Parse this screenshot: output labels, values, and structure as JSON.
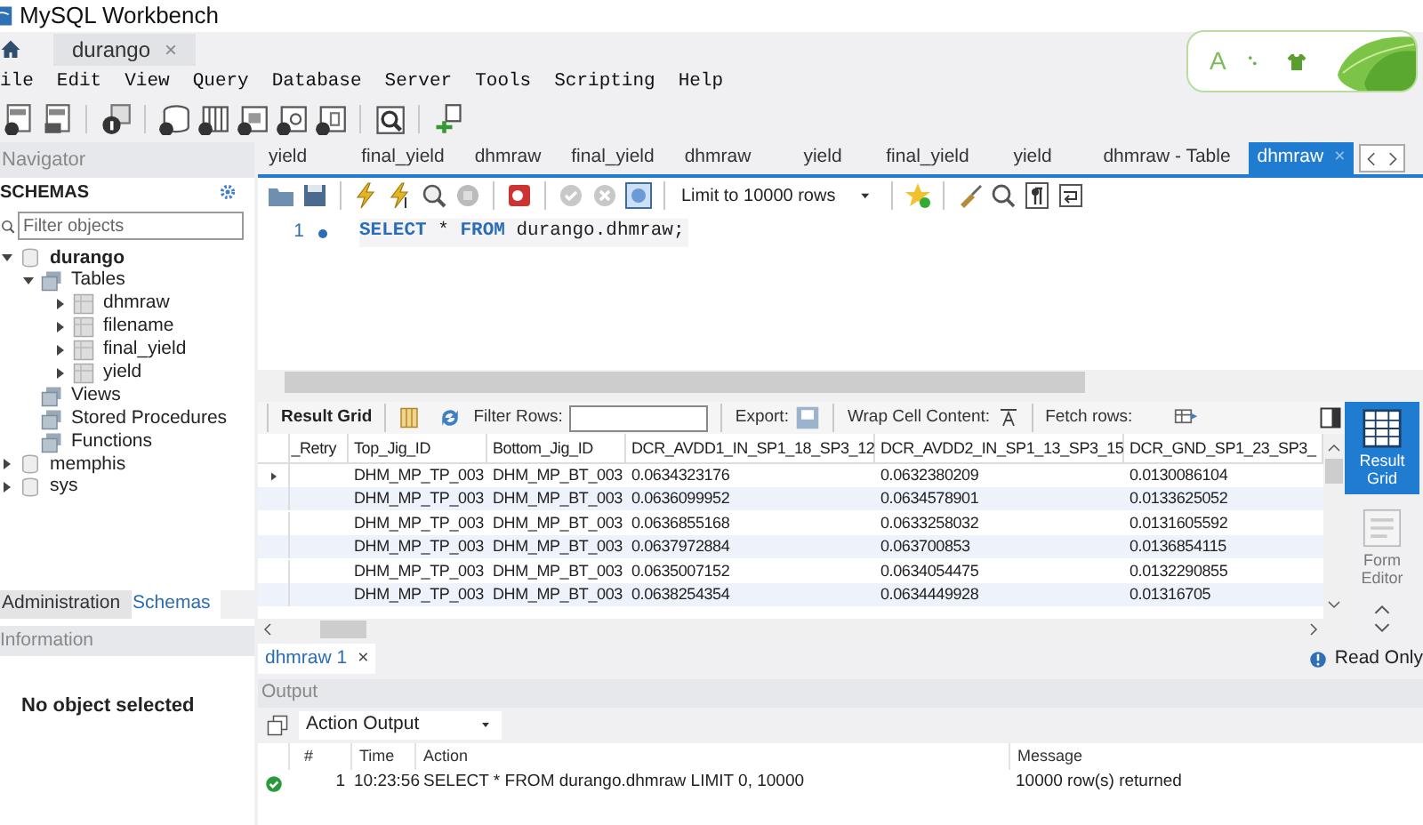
{
  "window": {
    "title": "MySQL Workbench"
  },
  "connection_tab": {
    "label": "durango",
    "close_glyph": "×"
  },
  "ime_widget": {
    "label": "A"
  },
  "menu": [
    "ile",
    "Edit",
    "View",
    "Query",
    "Database",
    "Server",
    "Tools",
    "Scripting",
    "Help"
  ],
  "navigator": {
    "title": "Navigator",
    "section": "SCHEMAS",
    "filter_placeholder": "Filter objects",
    "tree": [
      {
        "label": "durango",
        "kind": "schema",
        "active": true,
        "expanded": true,
        "children": [
          {
            "label": "Tables",
            "kind": "folder",
            "expanded": true,
            "children": [
              {
                "label": "dhmraw",
                "kind": "table",
                "expanded": false
              },
              {
                "label": "filename",
                "kind": "table",
                "expanded": false
              },
              {
                "label": "final_yield",
                "kind": "table",
                "expanded": false
              },
              {
                "label": "yield",
                "kind": "table",
                "expanded": false
              }
            ]
          },
          {
            "label": "Views",
            "kind": "folder"
          },
          {
            "label": "Stored Procedures",
            "kind": "folder"
          },
          {
            "label": "Functions",
            "kind": "folder"
          }
        ]
      },
      {
        "label": "memphis",
        "kind": "schema",
        "active": false,
        "expanded": false
      },
      {
        "label": "sys",
        "kind": "schema",
        "active": false,
        "expanded": false
      }
    ]
  },
  "navigator_tabs": [
    {
      "label": "Administration",
      "selected": false
    },
    {
      "label": "Schemas",
      "selected": true
    }
  ],
  "information": {
    "title": "Information",
    "message": "No object selected"
  },
  "query_tabs": [
    {
      "label": "yield",
      "selected": false
    },
    {
      "label": "final_yield",
      "selected": false
    },
    {
      "label": "dhmraw",
      "selected": false
    },
    {
      "label": "final_yield",
      "selected": false
    },
    {
      "label": "dhmraw",
      "selected": false
    },
    {
      "label": "yield",
      "selected": false
    },
    {
      "label": "final_yield",
      "selected": false
    },
    {
      "label": "yield",
      "selected": false
    },
    {
      "label": "dhmraw - Table",
      "selected": false
    },
    {
      "label": "dhmraw",
      "selected": true,
      "close_glyph": "×"
    }
  ],
  "editor": {
    "limit": "Limit to 10000 rows",
    "lines": [
      {
        "number": "1",
        "tokens": [
          {
            "text": "SELECT",
            "kind": "keyword"
          },
          {
            "text": " * ",
            "kind": "plain"
          },
          {
            "text": "FROM",
            "kind": "keyword"
          },
          {
            "text": " durango.dhmraw;",
            "kind": "plain"
          }
        ]
      }
    ]
  },
  "result_toolbar": {
    "grid_label": "Result Grid",
    "filter_label": "Filter Rows:",
    "export_label": "Export:",
    "wrap_label": "Wrap Cell Content:",
    "fetch_label": "Fetch rows:"
  },
  "result_grid": {
    "columns": [
      "_Retry",
      "Top_Jig_ID",
      "Bottom_Jig_ID",
      "DCR_AVDD1_IN_SP1_18_SP3_12",
      "DCR_AVDD2_IN_SP1_13_SP3_15",
      "DCR_GND_SP1_23_SP3_"
    ],
    "rows": [
      {
        "current": true,
        "cells": [
          "",
          "DHM_MP_TP_003",
          "DHM_MP_BT_003",
          "0.0634323176",
          "0.0632380209",
          "0.0130086104"
        ]
      },
      {
        "current": false,
        "cells": [
          "",
          "DHM_MP_TP_003",
          "DHM_MP_BT_003",
          "0.0636099952",
          "0.0634578901",
          "0.0133625052"
        ]
      },
      {
        "current": false,
        "cells": [
          "",
          "DHM_MP_TP_003",
          "DHM_MP_BT_003",
          "0.0636855168",
          "0.0633258032",
          "0.0131605592"
        ]
      },
      {
        "current": false,
        "cells": [
          "",
          "DHM_MP_TP_003",
          "DHM_MP_BT_003",
          "0.0637972884",
          "0.063700853",
          "0.0136854115"
        ]
      },
      {
        "current": false,
        "cells": [
          "",
          "DHM_MP_TP_003",
          "DHM_MP_BT_003",
          "0.0635007152",
          "0.0634054475",
          "0.0132290855"
        ]
      },
      {
        "current": false,
        "cells": [
          "",
          "DHM_MP_TP_003",
          "DHM_MP_BT_003",
          "0.0638254354",
          "0.0634449928",
          "0.01316705"
        ]
      }
    ]
  },
  "side_panel": [
    {
      "label": "Result Grid",
      "selected": true
    },
    {
      "label": "Form Editor",
      "selected": false
    }
  ],
  "result_tabs": [
    {
      "label": "dhmraw 1",
      "close_glyph": "×",
      "selected": true
    }
  ],
  "read_only": "Read Only",
  "output": {
    "title": "Output",
    "mode": "Action Output",
    "columns": [
      "#",
      "Time",
      "Action",
      "Message"
    ],
    "rows": [
      {
        "succeeded": true,
        "number": "1",
        "time": "10:23:56",
        "action": "SELECT * FROM durango.dhmraw LIMIT 0, 10000",
        "message": "10000 row(s) returned"
      }
    ]
  }
}
